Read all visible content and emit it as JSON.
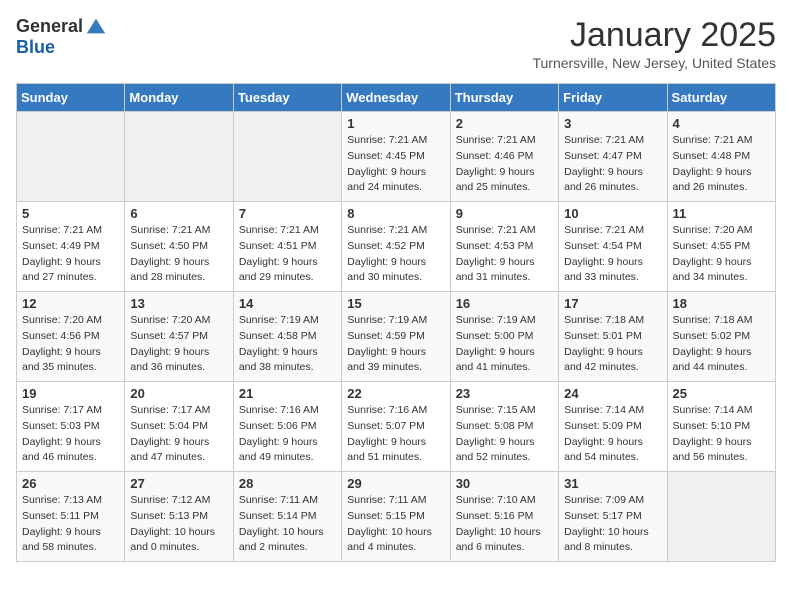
{
  "header": {
    "logo_general": "General",
    "logo_blue": "Blue",
    "title": "January 2025",
    "location": "Turnersville, New Jersey, United States"
  },
  "days_of_week": [
    "Sunday",
    "Monday",
    "Tuesday",
    "Wednesday",
    "Thursday",
    "Friday",
    "Saturday"
  ],
  "weeks": [
    [
      {
        "day": "",
        "info": ""
      },
      {
        "day": "",
        "info": ""
      },
      {
        "day": "",
        "info": ""
      },
      {
        "day": "1",
        "info": "Sunrise: 7:21 AM\nSunset: 4:45 PM\nDaylight: 9 hours\nand 24 minutes."
      },
      {
        "day": "2",
        "info": "Sunrise: 7:21 AM\nSunset: 4:46 PM\nDaylight: 9 hours\nand 25 minutes."
      },
      {
        "day": "3",
        "info": "Sunrise: 7:21 AM\nSunset: 4:47 PM\nDaylight: 9 hours\nand 26 minutes."
      },
      {
        "day": "4",
        "info": "Sunrise: 7:21 AM\nSunset: 4:48 PM\nDaylight: 9 hours\nand 26 minutes."
      }
    ],
    [
      {
        "day": "5",
        "info": "Sunrise: 7:21 AM\nSunset: 4:49 PM\nDaylight: 9 hours\nand 27 minutes."
      },
      {
        "day": "6",
        "info": "Sunrise: 7:21 AM\nSunset: 4:50 PM\nDaylight: 9 hours\nand 28 minutes."
      },
      {
        "day": "7",
        "info": "Sunrise: 7:21 AM\nSunset: 4:51 PM\nDaylight: 9 hours\nand 29 minutes."
      },
      {
        "day": "8",
        "info": "Sunrise: 7:21 AM\nSunset: 4:52 PM\nDaylight: 9 hours\nand 30 minutes."
      },
      {
        "day": "9",
        "info": "Sunrise: 7:21 AM\nSunset: 4:53 PM\nDaylight: 9 hours\nand 31 minutes."
      },
      {
        "day": "10",
        "info": "Sunrise: 7:21 AM\nSunset: 4:54 PM\nDaylight: 9 hours\nand 33 minutes."
      },
      {
        "day": "11",
        "info": "Sunrise: 7:20 AM\nSunset: 4:55 PM\nDaylight: 9 hours\nand 34 minutes."
      }
    ],
    [
      {
        "day": "12",
        "info": "Sunrise: 7:20 AM\nSunset: 4:56 PM\nDaylight: 9 hours\nand 35 minutes."
      },
      {
        "day": "13",
        "info": "Sunrise: 7:20 AM\nSunset: 4:57 PM\nDaylight: 9 hours\nand 36 minutes."
      },
      {
        "day": "14",
        "info": "Sunrise: 7:19 AM\nSunset: 4:58 PM\nDaylight: 9 hours\nand 38 minutes."
      },
      {
        "day": "15",
        "info": "Sunrise: 7:19 AM\nSunset: 4:59 PM\nDaylight: 9 hours\nand 39 minutes."
      },
      {
        "day": "16",
        "info": "Sunrise: 7:19 AM\nSunset: 5:00 PM\nDaylight: 9 hours\nand 41 minutes."
      },
      {
        "day": "17",
        "info": "Sunrise: 7:18 AM\nSunset: 5:01 PM\nDaylight: 9 hours\nand 42 minutes."
      },
      {
        "day": "18",
        "info": "Sunrise: 7:18 AM\nSunset: 5:02 PM\nDaylight: 9 hours\nand 44 minutes."
      }
    ],
    [
      {
        "day": "19",
        "info": "Sunrise: 7:17 AM\nSunset: 5:03 PM\nDaylight: 9 hours\nand 46 minutes."
      },
      {
        "day": "20",
        "info": "Sunrise: 7:17 AM\nSunset: 5:04 PM\nDaylight: 9 hours\nand 47 minutes."
      },
      {
        "day": "21",
        "info": "Sunrise: 7:16 AM\nSunset: 5:06 PM\nDaylight: 9 hours\nand 49 minutes."
      },
      {
        "day": "22",
        "info": "Sunrise: 7:16 AM\nSunset: 5:07 PM\nDaylight: 9 hours\nand 51 minutes."
      },
      {
        "day": "23",
        "info": "Sunrise: 7:15 AM\nSunset: 5:08 PM\nDaylight: 9 hours\nand 52 minutes."
      },
      {
        "day": "24",
        "info": "Sunrise: 7:14 AM\nSunset: 5:09 PM\nDaylight: 9 hours\nand 54 minutes."
      },
      {
        "day": "25",
        "info": "Sunrise: 7:14 AM\nSunset: 5:10 PM\nDaylight: 9 hours\nand 56 minutes."
      }
    ],
    [
      {
        "day": "26",
        "info": "Sunrise: 7:13 AM\nSunset: 5:11 PM\nDaylight: 9 hours\nand 58 minutes."
      },
      {
        "day": "27",
        "info": "Sunrise: 7:12 AM\nSunset: 5:13 PM\nDaylight: 10 hours\nand 0 minutes."
      },
      {
        "day": "28",
        "info": "Sunrise: 7:11 AM\nSunset: 5:14 PM\nDaylight: 10 hours\nand 2 minutes."
      },
      {
        "day": "29",
        "info": "Sunrise: 7:11 AM\nSunset: 5:15 PM\nDaylight: 10 hours\nand 4 minutes."
      },
      {
        "day": "30",
        "info": "Sunrise: 7:10 AM\nSunset: 5:16 PM\nDaylight: 10 hours\nand 6 minutes."
      },
      {
        "day": "31",
        "info": "Sunrise: 7:09 AM\nSunset: 5:17 PM\nDaylight: 10 hours\nand 8 minutes."
      },
      {
        "day": "",
        "info": ""
      }
    ]
  ]
}
